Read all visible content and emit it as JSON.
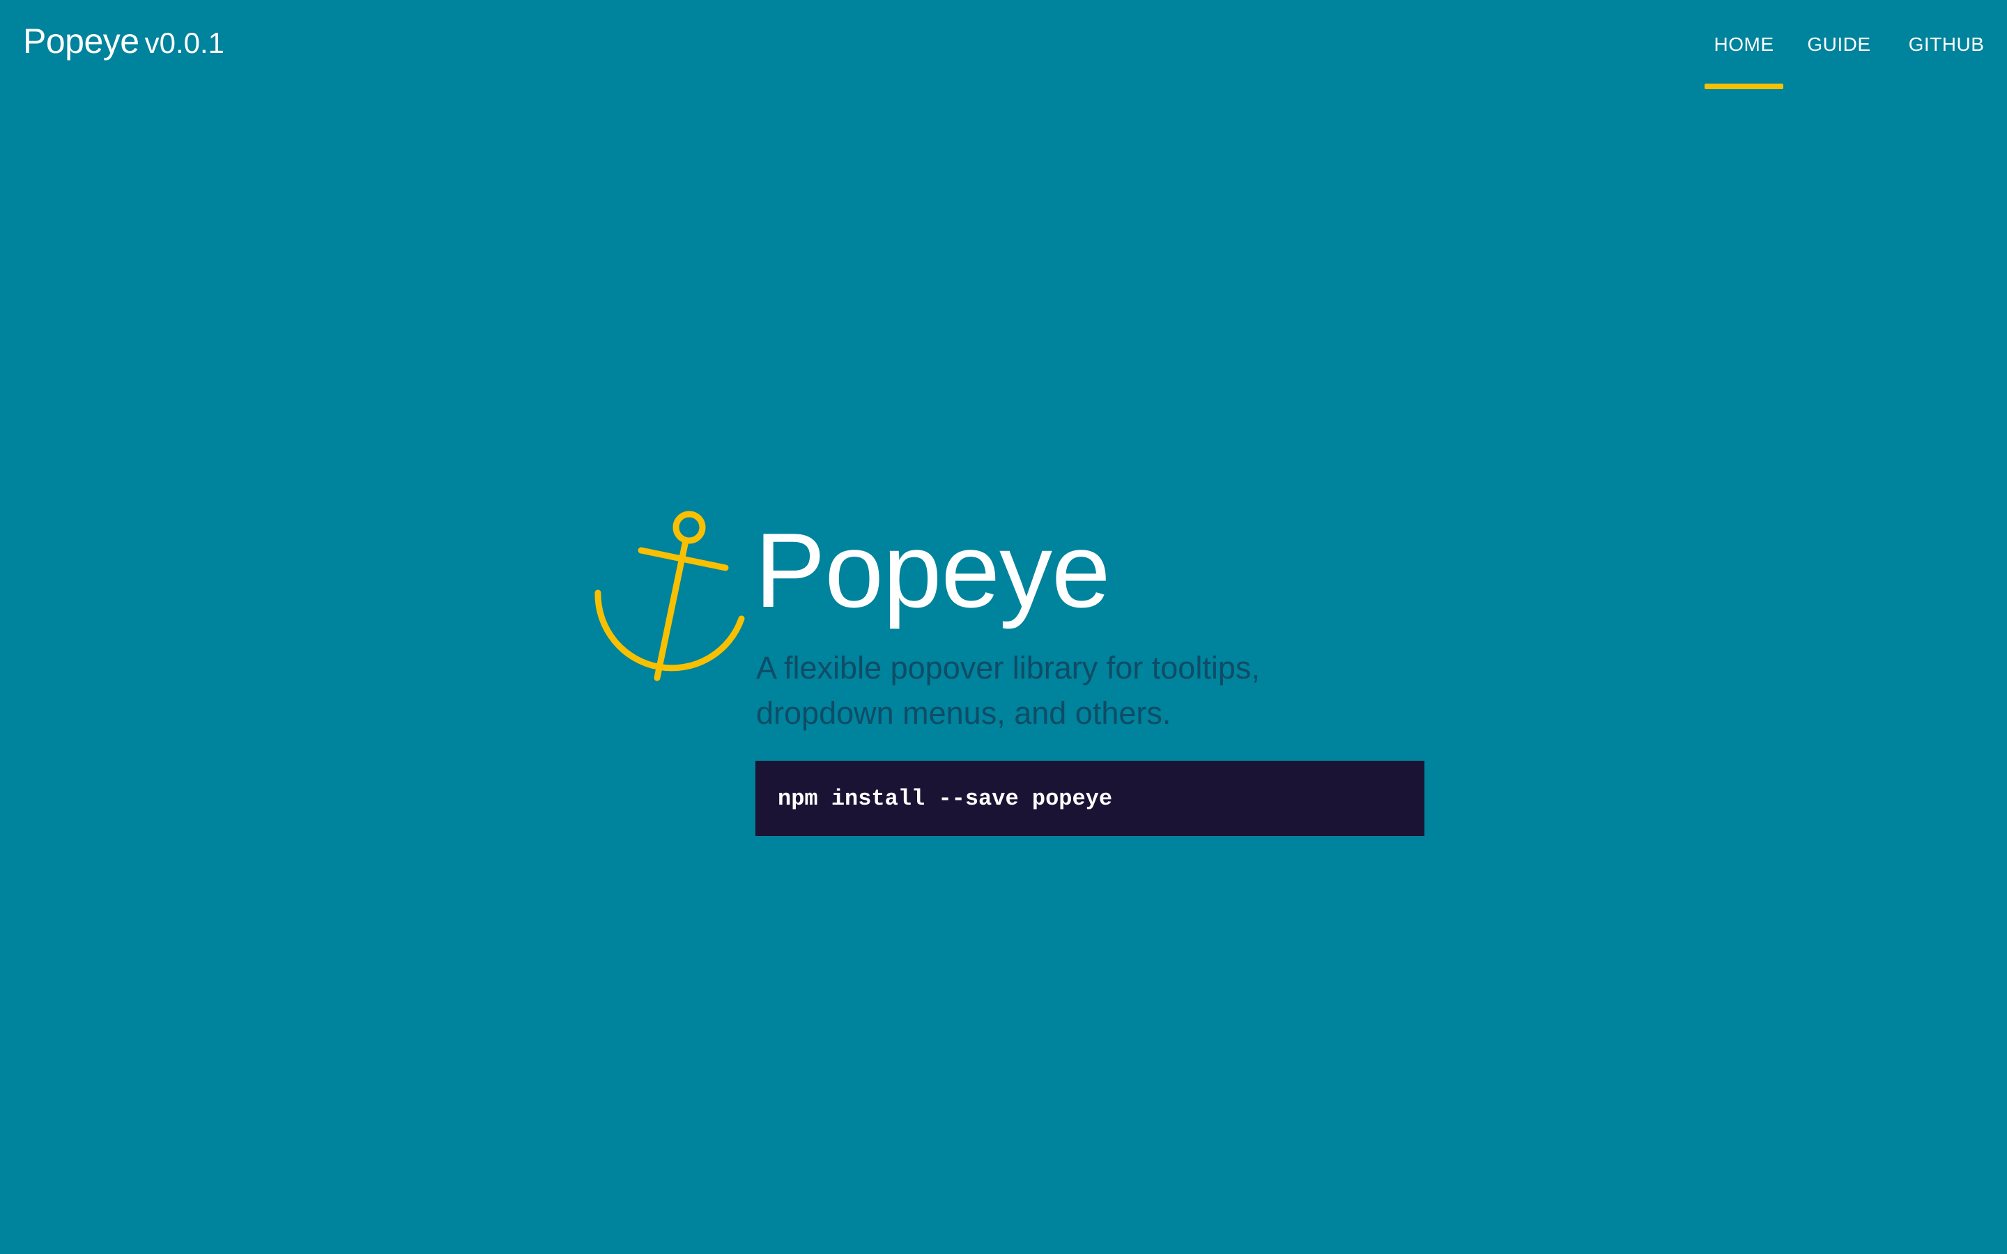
{
  "header": {
    "brand_name": "Popeye",
    "brand_version": "v0.0.1",
    "nav": [
      {
        "label": "HOME",
        "active": true
      },
      {
        "label": "GUIDE",
        "active": false
      },
      {
        "label": "GITHUB",
        "active": false
      }
    ]
  },
  "hero": {
    "title": "Popeye",
    "tagline": "A flexible popover library for tooltips, dropdown menus, and others.",
    "install_command": "npm install --save popeye",
    "logo_icon": "anchor-icon"
  },
  "colors": {
    "background": "#00839c",
    "accent": "#f9c001",
    "tagline_text": "#0f4c66",
    "code_background": "#1b1334",
    "text": "#ffffff"
  }
}
